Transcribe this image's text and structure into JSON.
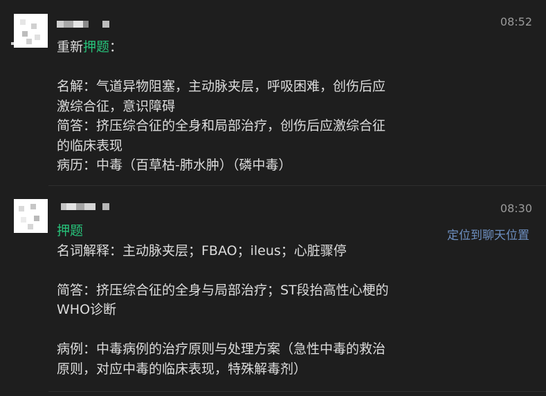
{
  "messages": [
    {
      "time": "08:52",
      "lines": [
        {
          "parts": [
            {
              "t": "重新"
            },
            {
              "t": "押题",
              "kw": true
            },
            {
              "t": "："
            }
          ]
        },
        {
          "blank": true
        },
        {
          "parts": [
            {
              "t": "名解：气道异物阻塞，主动脉夹层，呼吸困难，创伤后应"
            }
          ]
        },
        {
          "parts": [
            {
              "t": "激综合征，意识障碍"
            }
          ]
        },
        {
          "parts": [
            {
              "t": "简答：挤压综合征的全身和局部治疗，创伤后应激综合征"
            }
          ]
        },
        {
          "parts": [
            {
              "t": "的临床表现"
            }
          ]
        },
        {
          "parts": [
            {
              "t": "病历：中毒（百草枯-肺水肿）（磷中毒）"
            }
          ]
        }
      ]
    },
    {
      "time": "08:30",
      "locate_link": "定位到聊天位置",
      "lines": [
        {
          "parts": [
            {
              "t": "押题",
              "kw": true
            }
          ]
        },
        {
          "parts": [
            {
              "t": "名词解释：主动脉夹层；FBAO；ileus；心脏骤停"
            }
          ]
        },
        {
          "blank": true
        },
        {
          "parts": [
            {
              "t": "简答：挤压综合征的全身与局部治疗；ST段抬高性心梗的"
            }
          ]
        },
        {
          "parts": [
            {
              "t": "WHO诊断"
            }
          ]
        },
        {
          "blank": true
        },
        {
          "parts": [
            {
              "t": "病例：中毒病例的治疗原则与处理方案（急性中毒的救治"
            }
          ]
        },
        {
          "parts": [
            {
              "t": "原则，对应中毒的临床表现，特殊解毒剂）"
            }
          ]
        }
      ]
    }
  ],
  "colors": {
    "background": "#1e1e1e",
    "keyword": "#27c27a",
    "link": "#6d8fc0",
    "time": "#9a9a9a"
  }
}
